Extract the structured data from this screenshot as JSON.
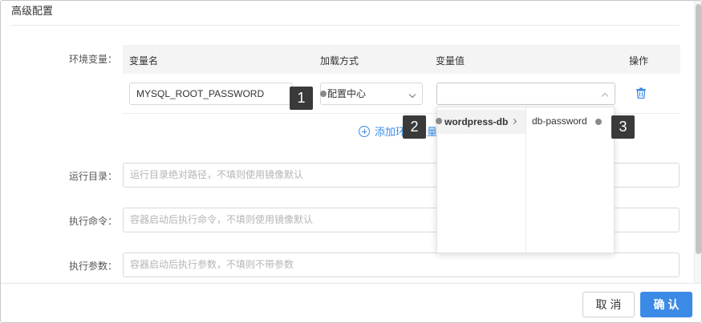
{
  "section": {
    "title": "高级配置"
  },
  "env": {
    "label": "环境变量：",
    "columns": {
      "name": "变量名",
      "load_method": "加载方式",
      "value": "变量值",
      "actions": "操作"
    },
    "row": {
      "name_value": "MYSQL_ROOT_PASSWORD",
      "load_method_value": "配置中心",
      "value_value": ""
    },
    "add_label": "添加环境变量"
  },
  "cascader": {
    "level1": "wordpress-db",
    "level2": "db-password"
  },
  "callouts": [
    "1",
    "2",
    "3"
  ],
  "fields": {
    "workdir": {
      "label": "运行目录：",
      "placeholder": "运行目录绝对路径，不填则使用镜像默认"
    },
    "command": {
      "label": "执行命令：",
      "placeholder": "容器启动后执行命令，不填则使用镜像默认"
    },
    "args": {
      "label": "执行参数：",
      "placeholder": "容器启动后执行参数，不填则不带参数"
    }
  },
  "footer": {
    "cancel_label": "取 消",
    "ok_label": "确 认"
  },
  "colors": {
    "accent": "#3b8be6",
    "badge": "#3a3a3a"
  },
  "icons": {
    "trash": "trash-icon",
    "add": "plus-circle-icon",
    "caret": "chevron-down-icon",
    "cascader_arrow": "chevron-right-icon"
  }
}
